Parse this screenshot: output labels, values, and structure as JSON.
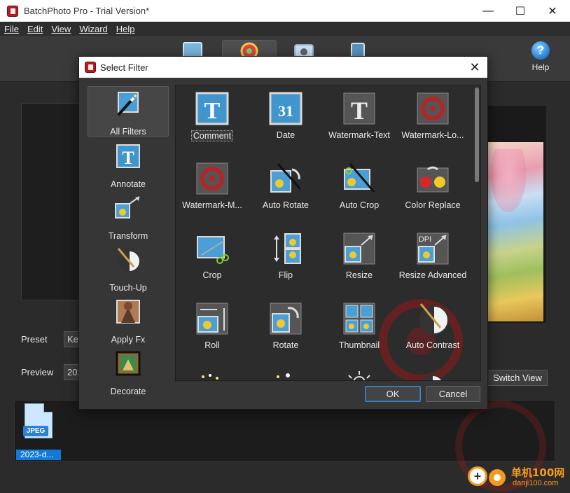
{
  "window": {
    "title": "BatchPhoto Pro - Trial Version*",
    "minimize": "—",
    "maximize": "☐",
    "close": "✕"
  },
  "menu": [
    "File",
    "Edit",
    "View",
    "Wizard",
    "Help"
  ],
  "toolbar": {
    "help_label": "Help",
    "help_symbol": "?"
  },
  "main": {
    "preset_label": "Preset",
    "preset_value": "Ke",
    "preview_label": "Preview",
    "preview_value": "202",
    "switch_view": "Switch View",
    "file": {
      "badge": "JPEG",
      "name": "2023-d..."
    }
  },
  "dialog": {
    "title": "Select Filter",
    "close": "✕",
    "categories": [
      {
        "label": "All Filters",
        "icon": "magic-wand-icon",
        "selected": true
      },
      {
        "label": "Annotate",
        "icon": "text-t-icon",
        "selected": false
      },
      {
        "label": "Transform",
        "icon": "transform-icon",
        "selected": false
      },
      {
        "label": "Touch-Up",
        "icon": "touch-up-icon",
        "selected": false
      },
      {
        "label": "Apply Fx",
        "icon": "apply-fx-icon",
        "selected": false
      },
      {
        "label": "Decorate",
        "icon": "decorate-icon",
        "selected": false
      }
    ],
    "filters": [
      {
        "label": "Comment",
        "icon": "comment-icon",
        "selected": true
      },
      {
        "label": "Date",
        "icon": "date-icon",
        "date_number": "31"
      },
      {
        "label": "Watermark-Text",
        "icon": "watermark-text-icon"
      },
      {
        "label": "Watermark-Lo...",
        "icon": "watermark-logo-icon"
      },
      {
        "label": "Watermark-M...",
        "icon": "watermark-multi-icon"
      },
      {
        "label": "Auto Rotate",
        "icon": "auto-rotate-icon"
      },
      {
        "label": "Auto Crop",
        "icon": "auto-crop-icon"
      },
      {
        "label": "Color Replace",
        "icon": "color-replace-icon"
      },
      {
        "label": "Crop",
        "icon": "crop-icon"
      },
      {
        "label": "Flip",
        "icon": "flip-icon"
      },
      {
        "label": "Resize",
        "icon": "resize-icon"
      },
      {
        "label": "Resize Advanced",
        "icon": "resize-advanced-icon",
        "badge": "DPI"
      },
      {
        "label": "Roll",
        "icon": "roll-icon"
      },
      {
        "label": "Rotate",
        "icon": "rotate-icon"
      },
      {
        "label": "Thumbnail",
        "icon": "thumbnail-icon"
      },
      {
        "label": "Auto Contrast",
        "icon": "auto-contrast-icon"
      }
    ],
    "ok": "OK",
    "cancel": "Cancel"
  },
  "site_watermark": {
    "cn": "单机100网",
    "en": "danji100.com"
  },
  "colors": {
    "accent_blue": "#0f7ad8",
    "orange": "#f39a1e",
    "app_red": "#b81c1c"
  }
}
